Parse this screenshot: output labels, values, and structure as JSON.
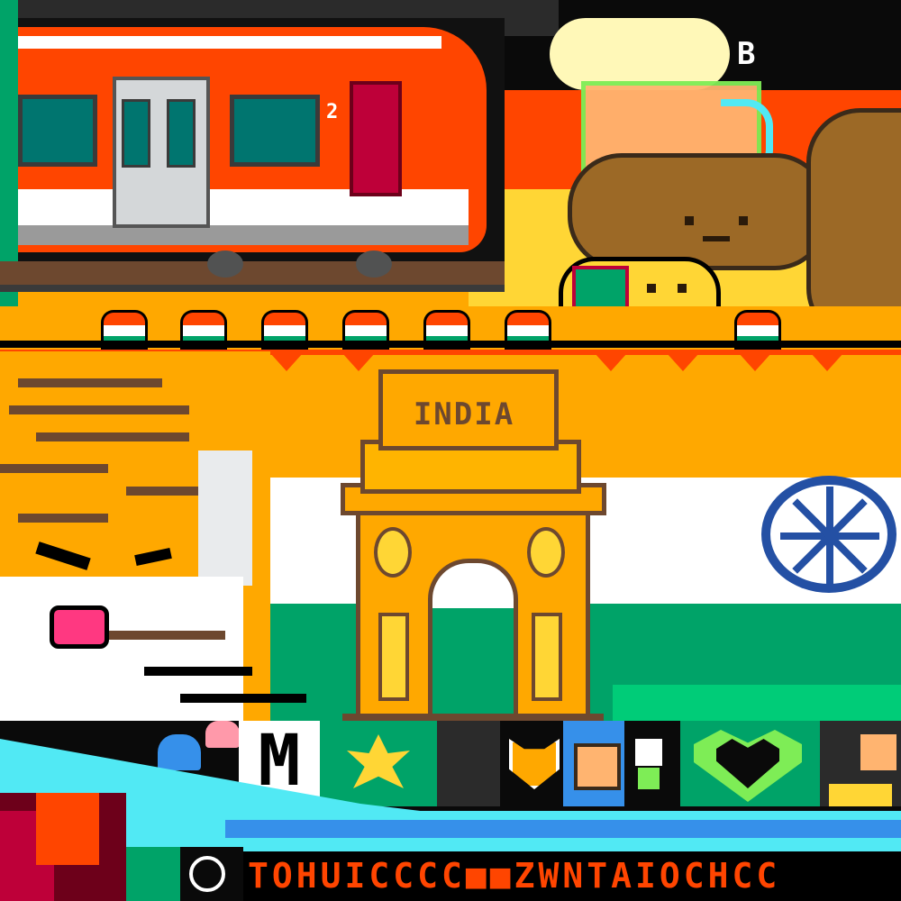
{
  "scene": {
    "gate_label": "INDIA",
    "train_number": "2",
    "corner_letter": "B",
    "tile_letter": "M",
    "ticker_text": "TOHUICCCC■■ZWNTAIOCHCC"
  },
  "palette": {
    "saffron": "#ffa800",
    "white": "#ffffff",
    "green": "#00a368",
    "chakra_blue": "#2450a4",
    "train_red": "#ff4500",
    "water": "#51e9f4"
  }
}
